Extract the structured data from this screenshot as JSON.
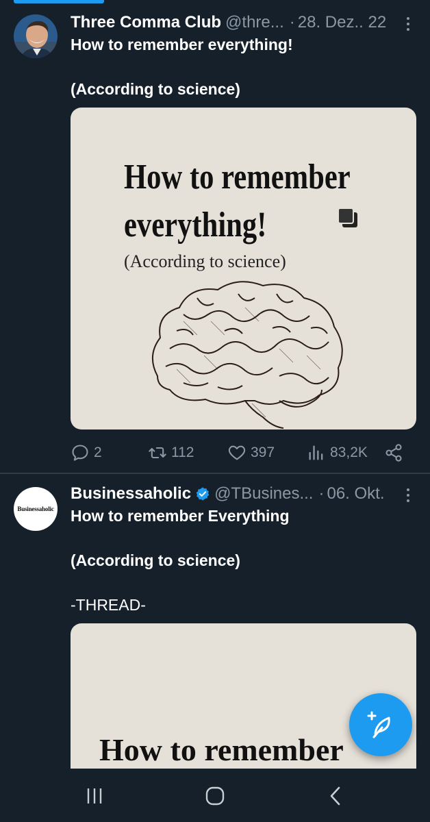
{
  "tweets": [
    {
      "display_name": "Three Comma Club",
      "handle": "@thre...",
      "dot": "·",
      "date": "28. Dez.. 22",
      "verified": false,
      "lines": [
        "How to remember everything!",
        "(According to science)"
      ],
      "media": {
        "title_line1": "How to remember",
        "title_line2": "everything!",
        "subtitle": "(According to science)"
      },
      "actions": {
        "replies": "2",
        "retweets": "112",
        "likes": "397",
        "views": "83,2K"
      }
    },
    {
      "display_name": "Businessaholic",
      "handle": "@TBusines...",
      "dot": "·",
      "date": "06. Okt.",
      "verified": true,
      "avatar_text": "Businessaholic",
      "lines": [
        "How to remember Everything",
        "(According to science)",
        "-THREAD-"
      ],
      "media": {
        "title_line1": "How to remember"
      }
    }
  ],
  "colors": {
    "background": "#15202b",
    "accent": "#1d9bf0",
    "secondary_text": "#8b98a5"
  },
  "icons": {
    "reply": "reply-icon",
    "retweet": "retweet-icon",
    "like": "heart-icon",
    "views": "views-icon",
    "share": "share-icon",
    "more": "more-icon",
    "compose": "compose-icon",
    "multi_image": "multi-image-icon"
  }
}
